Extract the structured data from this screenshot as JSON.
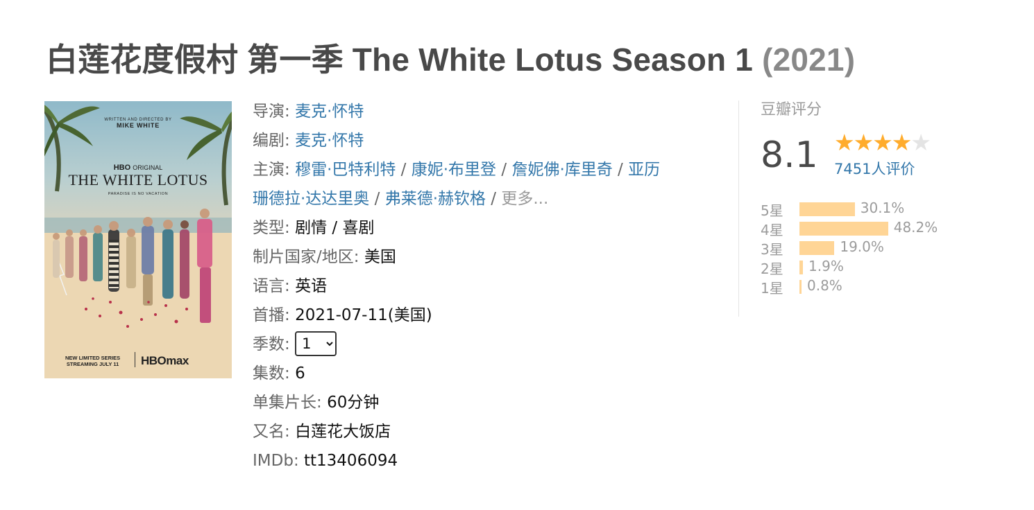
{
  "title": {
    "main": "白莲花度假村 第一季 The White Lotus Season 1",
    "year": "(2021)"
  },
  "poster": {
    "written_by": "WRITTEN AND DIRECTED BY",
    "director": "MIKE WHITE",
    "network": "HBO",
    "network_sub": "ORIGINAL",
    "show_name": "THE WHITE LOTUS",
    "tagline": "PARADISE IS NO VACATION",
    "series_line1": "NEW LIMITED SERIES",
    "series_line2": "STREAMING JULY 11",
    "platform": "HBOmax"
  },
  "info": {
    "director_label": "导演",
    "director": "麦克·怀特",
    "writer_label": "编剧",
    "writer": "麦克·怀特",
    "cast_label": "主演",
    "cast": [
      "穆雷·巴特利特",
      "康妮·布里登",
      "詹妮佛·库里奇",
      "亚历",
      "珊德拉·达达里奥",
      "弗莱德·赫钦格"
    ],
    "more": "更多...",
    "genre_label": "类型",
    "genres": [
      "剧情",
      "喜剧"
    ],
    "country_label": "制片国家/地区",
    "country": "美国",
    "language_label": "语言",
    "language": "英语",
    "premiere_label": "首播",
    "premiere": "2021-07-11(美国)",
    "season_label": "季数",
    "season_selected": "1",
    "episodes_label": "集数",
    "episodes": "6",
    "runtime_label": "单集片长",
    "runtime": "60分钟",
    "aka_label": "又名",
    "aka": "白莲花大饭店",
    "imdb_label": "IMDb",
    "imdb": "tt13406094"
  },
  "rating": {
    "title": "豆瓣评分",
    "score": "8.1",
    "stars": 4,
    "count": "7451人评价",
    "distribution": [
      {
        "label": "5星",
        "percent": 30.1,
        "text": "30.1%"
      },
      {
        "label": "4星",
        "percent": 48.2,
        "text": "48.2%"
      },
      {
        "label": "3星",
        "percent": 19.0,
        "text": "19.0%"
      },
      {
        "label": "2星",
        "percent": 1.9,
        "text": "1.9%"
      },
      {
        "label": "1星",
        "percent": 0.8,
        "text": "0.8%"
      }
    ]
  },
  "colors": {
    "link": "#3377aa",
    "star": "#ffac2d",
    "bar": "#ffd596",
    "title": "#494949"
  }
}
